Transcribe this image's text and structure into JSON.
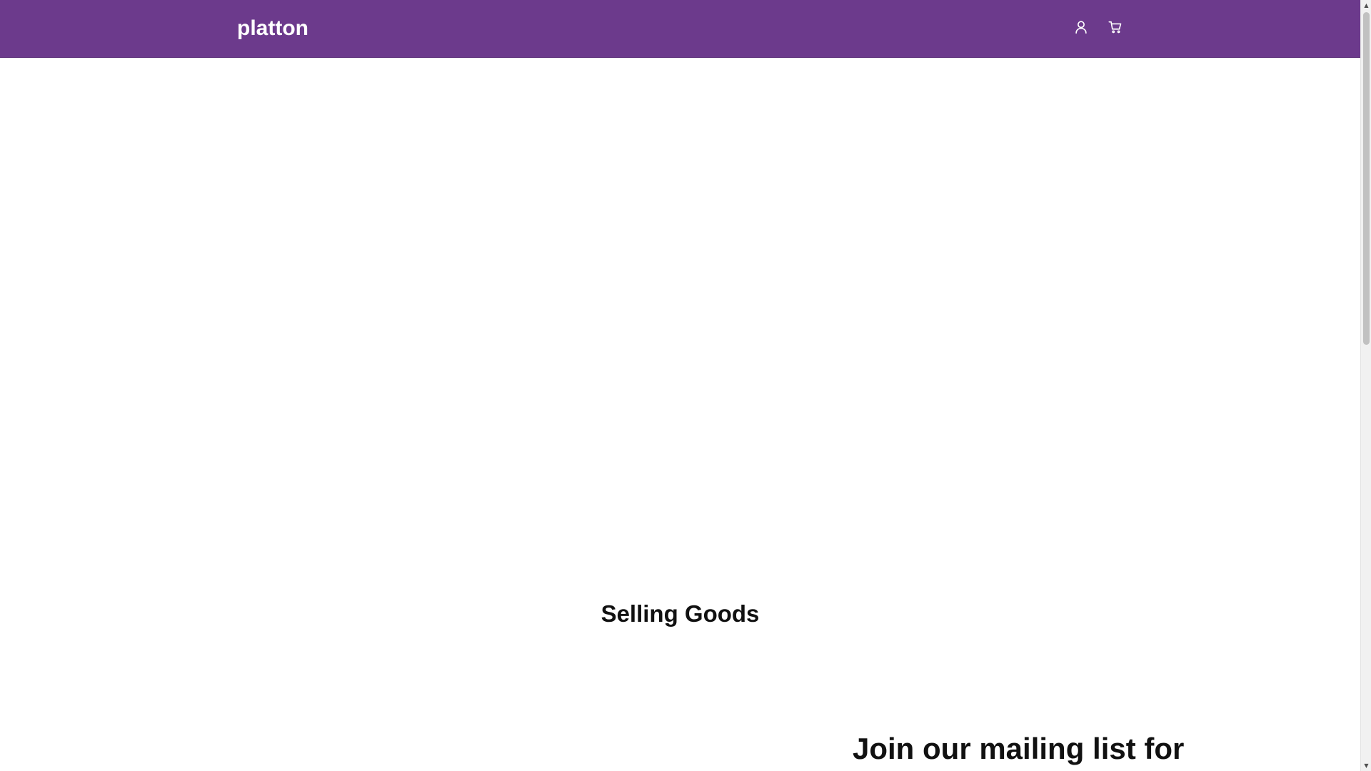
{
  "header": {
    "logo": "platton",
    "background_color": "#6c3a8c",
    "icons": {
      "account": "user-icon",
      "cart": "cart-icon"
    }
  },
  "sections": {
    "featured_title": "Selling Goods",
    "mailing_title": "Join our mailing list for"
  },
  "scrollbar": {
    "up_glyph": "▲",
    "down_glyph": "▼"
  }
}
